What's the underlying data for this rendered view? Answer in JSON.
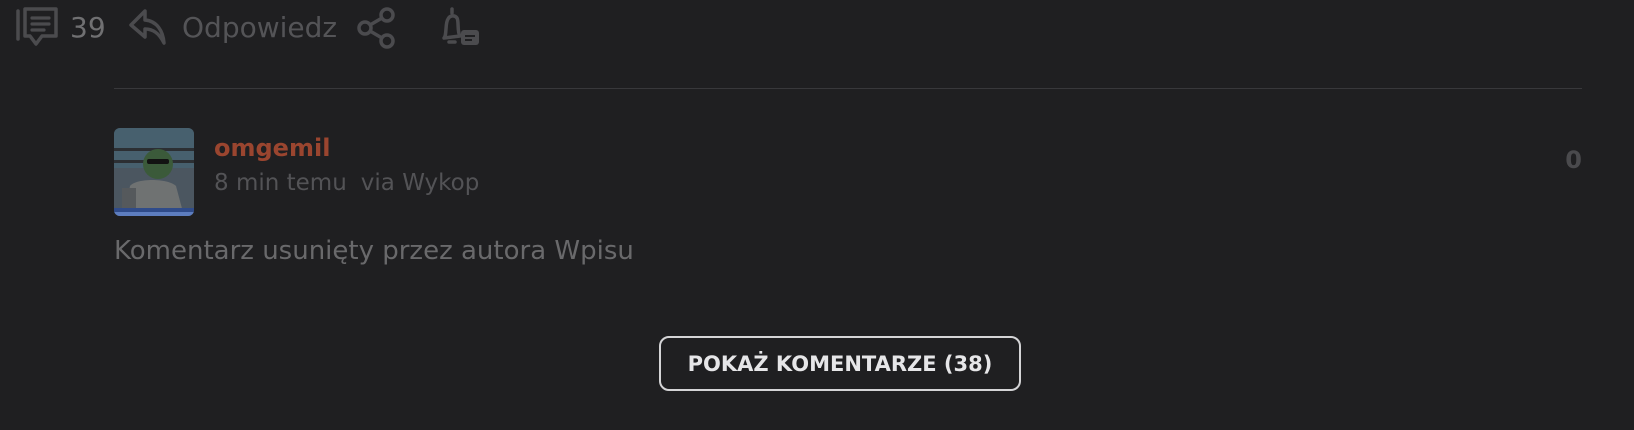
{
  "actions": {
    "comments_count": "39",
    "reply_label": "Odpowiedz"
  },
  "comment": {
    "author": "omgemil",
    "time": "8 min temu",
    "via": "via Wykop",
    "votes": "0",
    "text": "Komentarz usunięty przez autora Wpisu"
  },
  "show_comments_label": "POKAŻ KOMENTARZE (38)",
  "colors": {
    "background": "#1f1f21",
    "author": "#9a452f",
    "button_border": "#d4d4d6"
  }
}
